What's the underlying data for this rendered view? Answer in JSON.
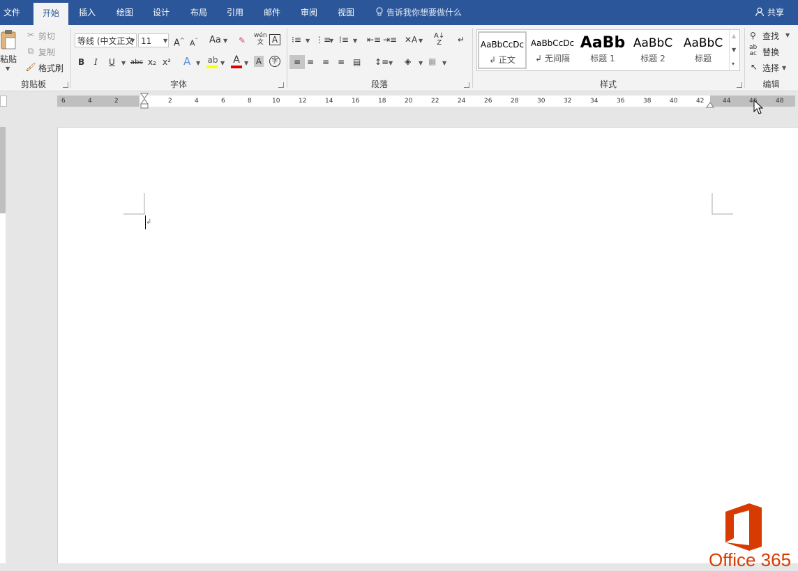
{
  "tabs": [
    "文件",
    "开始",
    "插入",
    "绘图",
    "设计",
    "布局",
    "引用",
    "邮件",
    "审阅",
    "视图"
  ],
  "active_tab": "开始",
  "tell_me": "告诉我你想要做什么",
  "share": "共享",
  "clipboard": {
    "paste": "粘贴",
    "cut": "剪切",
    "copy": "复制",
    "format_painter": "格式刷",
    "label": "剪贴板"
  },
  "font": {
    "font_name": "等线 (中文正文",
    "font_size": "11",
    "change_case": "Aa",
    "bold": "B",
    "italic": "I",
    "underline": "U",
    "strikethrough": "abc",
    "subscript": "x₂",
    "superscript": "x²",
    "phonetic": "wén",
    "label": "字体"
  },
  "paragraph": {
    "label": "段落"
  },
  "styles": {
    "label": "样式",
    "items": [
      {
        "preview": "AaBbCcDc",
        "name": "正文"
      },
      {
        "preview": "AaBbCcDc",
        "name": "无间隔"
      },
      {
        "preview": "AaBb",
        "name": "标题 1"
      },
      {
        "preview": "AaBbC",
        "name": "标题 2"
      },
      {
        "preview": "AaBbC",
        "name": "标题"
      }
    ]
  },
  "editing": {
    "find": "查找",
    "replace": "替换",
    "select": "选择",
    "label": "编辑"
  },
  "ruler": {
    "left_labels": [
      "6",
      "4",
      "2"
    ],
    "labels": [
      "2",
      "4",
      "6",
      "8",
      "10",
      "12",
      "14",
      "16",
      "18",
      "20",
      "22",
      "24",
      "26",
      "28",
      "30",
      "32",
      "34",
      "36",
      "38",
      "40",
      "42",
      "44",
      "46",
      "48"
    ]
  },
  "watermark": "Office 365",
  "colors": {
    "tabbar": "#2b579a",
    "ribbon": "#f3f3f3",
    "page": "#ffffff",
    "office_logo": "#d83b01"
  }
}
